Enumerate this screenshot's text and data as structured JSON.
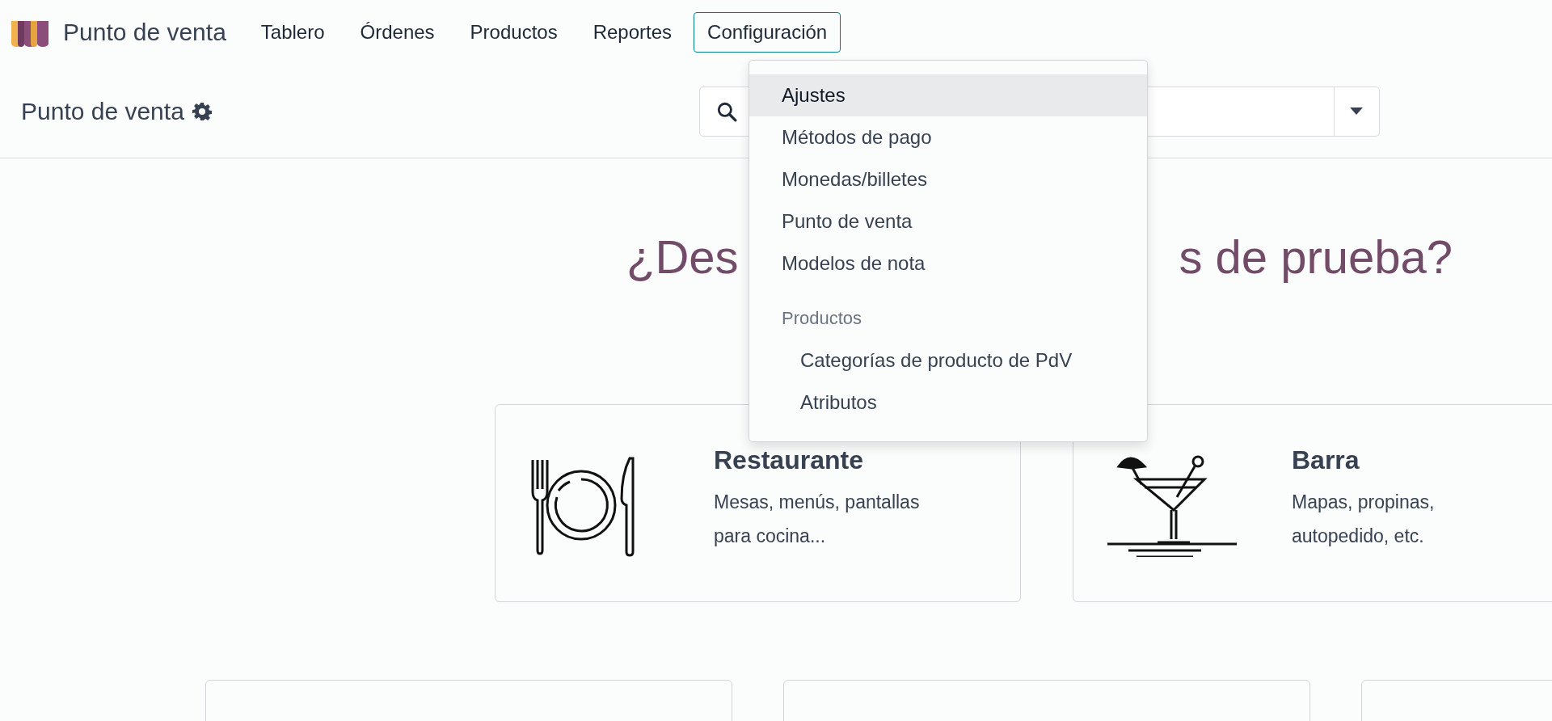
{
  "app": {
    "name": "Punto de venta"
  },
  "nav": [
    {
      "label": "Tablero",
      "selected": false
    },
    {
      "label": "Órdenes",
      "selected": false
    },
    {
      "label": "Productos",
      "selected": false
    },
    {
      "label": "Reportes",
      "selected": false
    },
    {
      "label": "Configuración",
      "selected": true
    }
  ],
  "control_panel": {
    "title": "Punto de venta"
  },
  "menu": {
    "items": [
      {
        "kind": "item",
        "label": "Ajustes",
        "selected": true
      },
      {
        "kind": "item",
        "label": "Métodos de pago",
        "selected": false
      },
      {
        "kind": "item",
        "label": "Monedas/billetes",
        "selected": false
      },
      {
        "kind": "item",
        "label": "Punto de venta",
        "selected": false
      },
      {
        "kind": "item",
        "label": "Modelos de nota",
        "selected": false
      },
      {
        "kind": "header",
        "label": "Productos"
      },
      {
        "kind": "subitem",
        "label": "Categorías de producto de PdV",
        "selected": false
      },
      {
        "kind": "subitem",
        "label": "Atributos",
        "selected": false
      }
    ]
  },
  "heading": {
    "parts": [
      "¿Des",
      "s de prueba?"
    ]
  },
  "cards": [
    {
      "kind": "restaurant",
      "title": "Restaurante",
      "description": "Mesas, menús, pantallas para cocina..."
    },
    {
      "kind": "bar",
      "title": "Barra",
      "description": "Mapas, propinas, autopedido, etc."
    }
  ],
  "lower_cards": [
    {
      "kind": "partial"
    },
    {
      "kind": "partial"
    },
    {
      "kind": "partial"
    }
  ]
}
